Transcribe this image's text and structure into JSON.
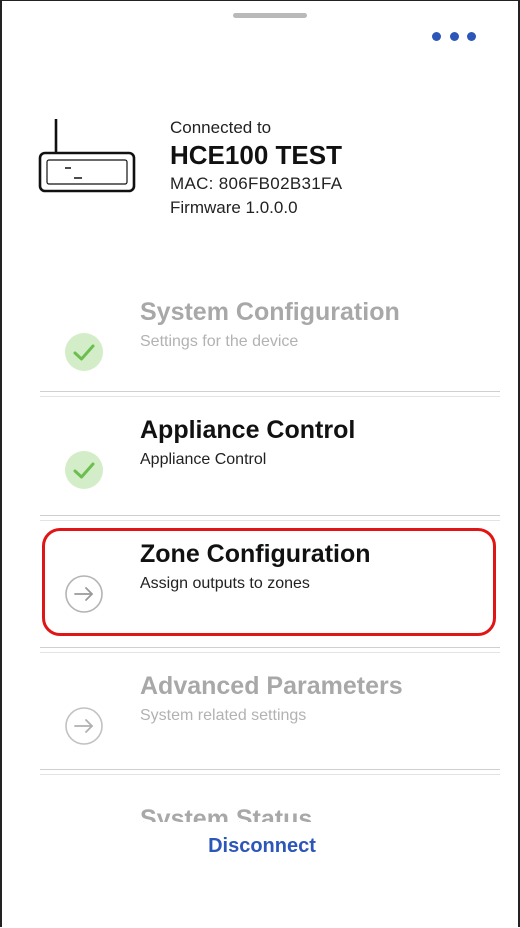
{
  "header": {
    "more_icon": "more-horizontal-icon"
  },
  "device": {
    "icon": "router-icon",
    "connected_label": "Connected to",
    "name": "HCE100 TEST",
    "mac": "MAC: 806FB02B31FA",
    "firmware": "Firmware 1.0.0.0"
  },
  "menu": {
    "items": [
      {
        "title": "System Configuration",
        "subtitle": "Settings for the device",
        "status_icon": "check-circle-icon",
        "state": "completed-disabled"
      },
      {
        "title": "Appliance Control",
        "subtitle": "Appliance Control",
        "status_icon": "check-circle-icon",
        "state": "completed"
      },
      {
        "title": "Zone Configuration",
        "subtitle": "Assign outputs to zones",
        "status_icon": "arrow-right-circle-icon",
        "state": "active"
      },
      {
        "title": "Advanced Parameters",
        "subtitle": "System related settings",
        "status_icon": "arrow-right-circle-icon",
        "state": "disabled"
      },
      {
        "title": "System Status",
        "state": "disabled"
      }
    ]
  },
  "footer": {
    "disconnect_label": "Disconnect"
  },
  "colors": {
    "accent": "#2c56b8",
    "check_bg": "#d3edc8",
    "check_mark": "#6cbf4f",
    "disabled_text": "#a8a8a8",
    "highlight": "#e01515"
  }
}
